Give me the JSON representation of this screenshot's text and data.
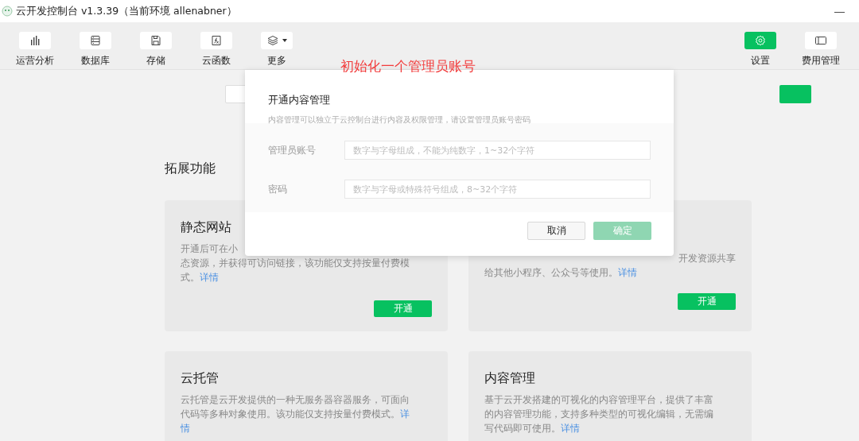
{
  "window": {
    "title": "云开发控制台 v1.3.39（当前环境 allenabner）",
    "minimize": "—"
  },
  "toolbar": {
    "left": [
      {
        "label": "运营分析",
        "selected": false
      },
      {
        "label": "数据库",
        "selected": false
      },
      {
        "label": "存储",
        "selected": false
      },
      {
        "label": "云函数",
        "selected": false
      },
      {
        "label": "更多",
        "selected": false
      }
    ],
    "right": [
      {
        "label": "设置",
        "selected": true
      },
      {
        "label": "费用管理",
        "selected": false
      }
    ]
  },
  "annotation": "初始化一个管理员账号",
  "section_title": "拓展功能",
  "cards": [
    {
      "title": "静态网站",
      "lines": [
        {
          "text": "开通后可在小"
        },
        {
          "text": "态资源，并获得可访问链接，该功能仅支持按量付费模"
        },
        {
          "text": "式。",
          "link": "详情"
        }
      ],
      "button": "开通"
    },
    {
      "lines": [
        {
          "text": "开发资源共享"
        },
        {
          "text": "给其他小程序、公众号等使用。",
          "link": "详情"
        }
      ],
      "button": "开通"
    },
    {
      "title": "云托管",
      "lines": [
        {
          "text": "云托管是云开发提供的一种无服务器容器服务，可面向"
        },
        {
          "text": "代码等多种对象使用。该功能仅支持按量付费模式。",
          "link": "详"
        },
        {
          "link": "情"
        }
      ]
    },
    {
      "title": "内容管理",
      "lines": [
        {
          "text": "基于云开发搭建的可视化的内容管理平台，提供了丰富"
        },
        {
          "text": "的内容管理功能，支持多种类型的可视化编辑，无需编"
        },
        {
          "text": "写代码即可使用。",
          "link": "详情"
        }
      ]
    }
  ],
  "dialog": {
    "title": "开通内容管理",
    "subtitle": "内容管理可以独立于云控制台进行内容及权限管理，请设置管理员账号密码",
    "fields": [
      {
        "label": "管理员账号",
        "placeholder": "数字与字母组成，不能为纯数字，1~32个字符"
      },
      {
        "label": "密码",
        "placeholder": "数字与字母或特殊符号组成，8~32个字符"
      }
    ],
    "buttons": [
      {
        "label": "取消",
        "kind": "default"
      },
      {
        "label": "确定",
        "kind": "primary",
        "disabled": true
      }
    ]
  }
}
